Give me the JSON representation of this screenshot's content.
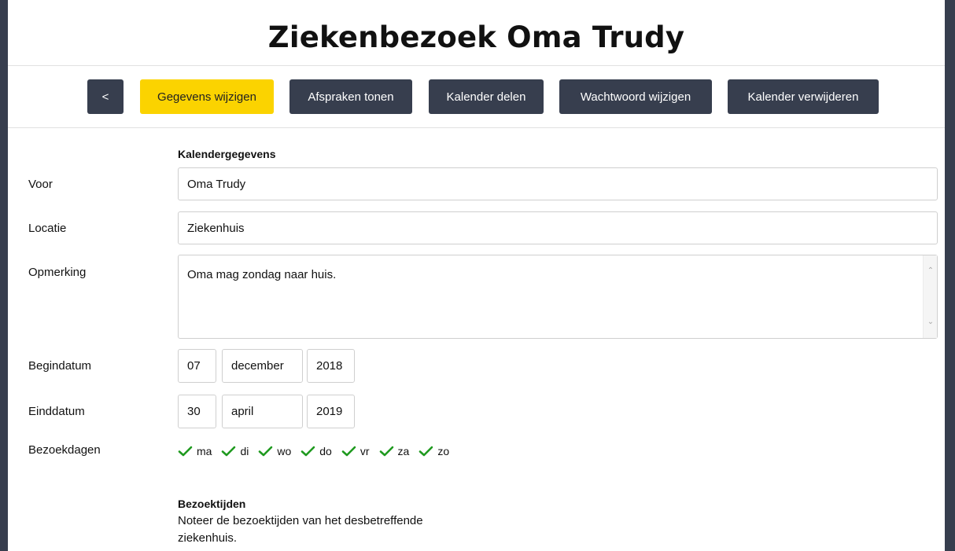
{
  "page": {
    "title": "Ziekenbezoek Oma Trudy"
  },
  "toolbar": {
    "back_label": "<",
    "edit_label": "Gegevens wijzigen",
    "appointments_label": "Afspraken tonen",
    "share_label": "Kalender delen",
    "password_label": "Wachtwoord wijzigen",
    "delete_label": "Kalender verwijderen"
  },
  "form": {
    "section_title": "Kalendergegevens",
    "voor": {
      "label": "Voor",
      "value": "Oma Trudy"
    },
    "locatie": {
      "label": "Locatie",
      "value": "Ziekenhuis"
    },
    "opmerking": {
      "label": "Opmerking",
      "value": "Oma mag zondag naar huis."
    },
    "begindatum": {
      "label": "Begindatum",
      "day": "07",
      "month": "december",
      "year": "2018"
    },
    "einddatum": {
      "label": "Einddatum",
      "day": "30",
      "month": "april",
      "year": "2019"
    },
    "bezoekdagen": {
      "label": "Bezoekdagen",
      "days": [
        {
          "label": "ma",
          "checked": true
        },
        {
          "label": "di",
          "checked": true
        },
        {
          "label": "wo",
          "checked": true
        },
        {
          "label": "do",
          "checked": true
        },
        {
          "label": "vr",
          "checked": true
        },
        {
          "label": "za",
          "checked": true
        },
        {
          "label": "zo",
          "checked": true
        }
      ]
    },
    "bezoektijden": {
      "title": "Bezoektijden",
      "description": "Noteer de bezoektijden van het desbetreffende ziekenhuis."
    }
  },
  "colors": {
    "dark": "#373e4e",
    "accent": "#fbd300",
    "check": "#1f9a1f"
  }
}
